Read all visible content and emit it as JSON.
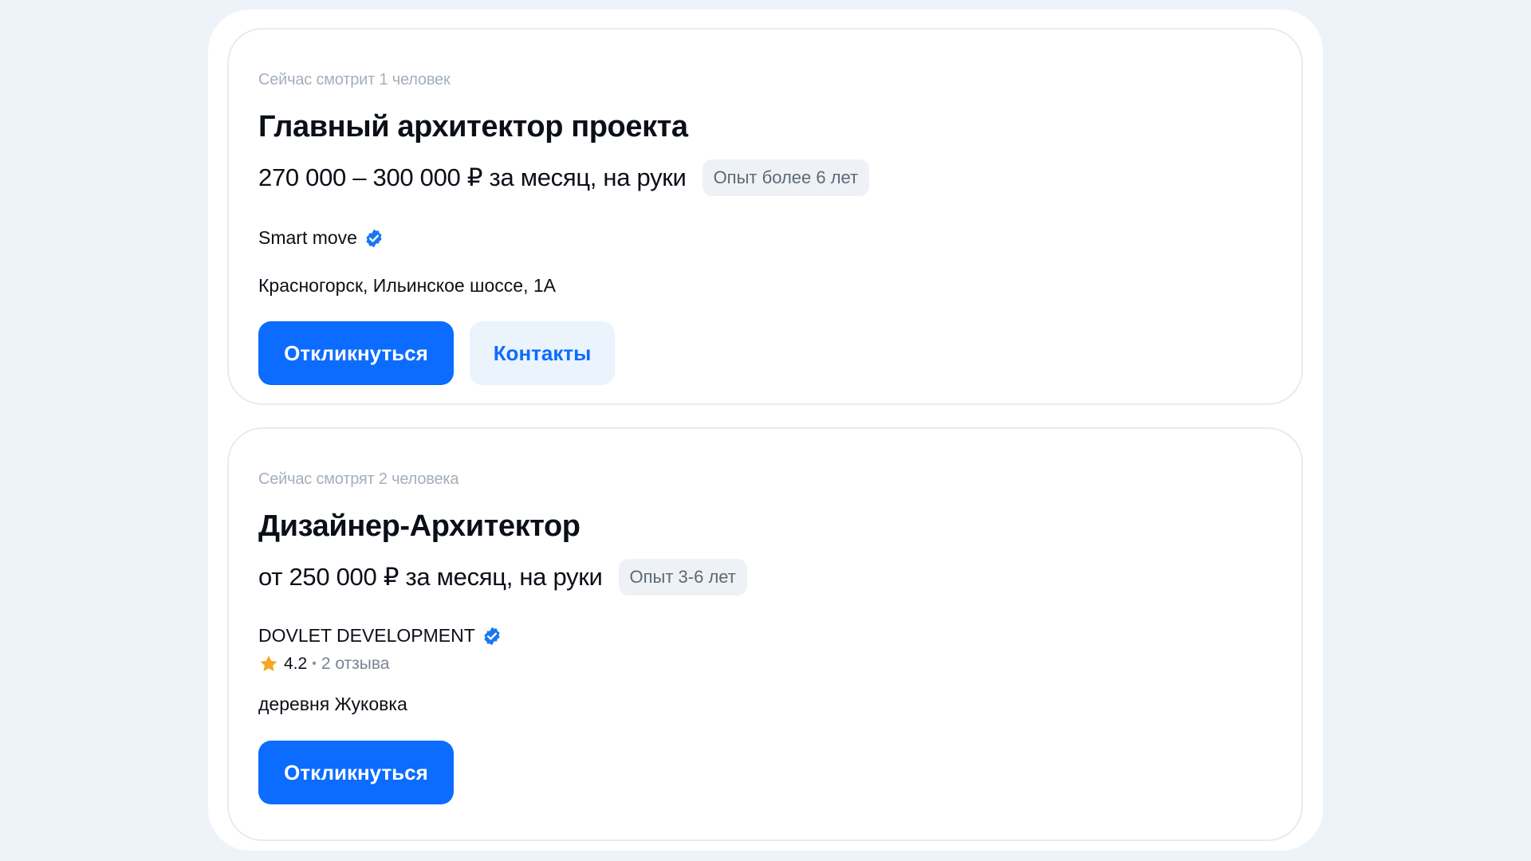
{
  "vacancies": [
    {
      "viewers": "Сейчас смотрит 1 человек",
      "title": "Главный архитектор проекта",
      "salary": "270 000 – 300 000 ₽ за месяц, на руки",
      "experience": "Опыт более 6 лет",
      "company": "Smart move",
      "address": "Красногорск, Ильинское шоссе, 1А",
      "respond_label": "Откликнуться",
      "contacts_label": "Контакты"
    },
    {
      "viewers": "Сейчас смотрят 2 человека",
      "title": "Дизайнер-Архитектор",
      "salary": "от 250 000 ₽ за месяц, на руки",
      "experience": "Опыт 3-6 лет",
      "company": "DOVLET DEVELOPMENT",
      "rating": "4.2",
      "rating_separator": "•",
      "reviews": "2 отзыва",
      "address": "деревня Жуковка",
      "respond_label": "Откликнуться"
    }
  ],
  "icons": {
    "verified": "verified-badge-icon",
    "star": "star-icon"
  },
  "colors": {
    "accent": "#0b6cff",
    "star": "#f5a623",
    "background": "#eef3fa"
  }
}
